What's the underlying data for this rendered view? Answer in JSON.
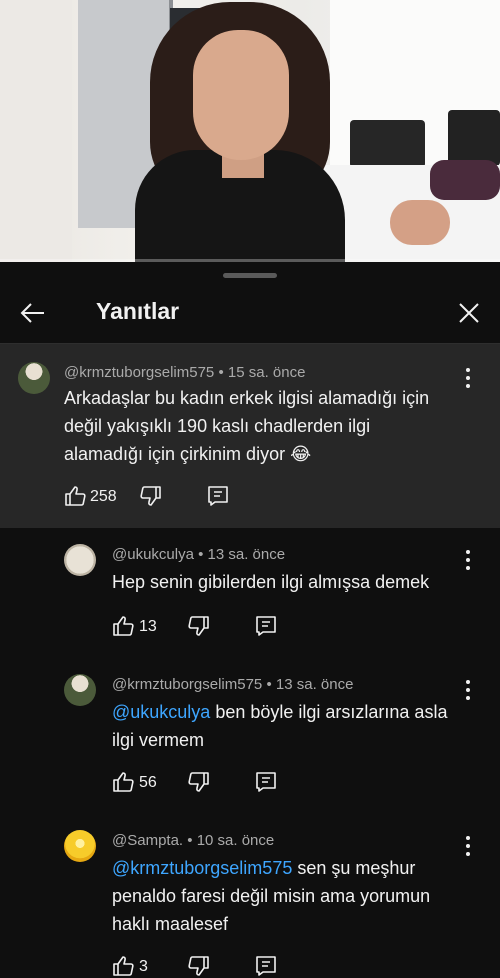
{
  "sheet": {
    "title": "Yanıtlar"
  },
  "parent_comment": {
    "author": "@krmztuborgselim575",
    "time": "15 sa. önce",
    "text": "Arkadaşlar bu kadın erkek ilgisi alamadığı için değil yakışıklı 190 kaslı chadlerden ilgi alamadığı için çirkinim diyor 😂",
    "likes": "258",
    "avatar_icon": "soldier-avatar"
  },
  "replies": [
    {
      "author": "@ukukculya",
      "time": "13 sa. önce",
      "mention": "",
      "text": "Hep senin gibilerden ilgi almışsa demek",
      "likes": "13"
    },
    {
      "author": "@krmztuborgselim575",
      "time": "13 sa. önce",
      "mention": "@ukukculya",
      "text": " ben böyle ilgi arsızlarına asla ilgi vermem",
      "likes": "56"
    },
    {
      "author": "@Sampta.",
      "time": "10 sa. önce",
      "mention": "@krmztuborgselim575",
      "text": "  sen şu meşhur penaldo faresi değil misin ama yorumun haklı maalesef",
      "likes": "3"
    }
  ],
  "meta_separator": " • ",
  "colors": {
    "background": "#0f0f0f",
    "parent_background": "#272727",
    "mention": "#3ea6ff",
    "meta_text": "#aaaaaa"
  }
}
